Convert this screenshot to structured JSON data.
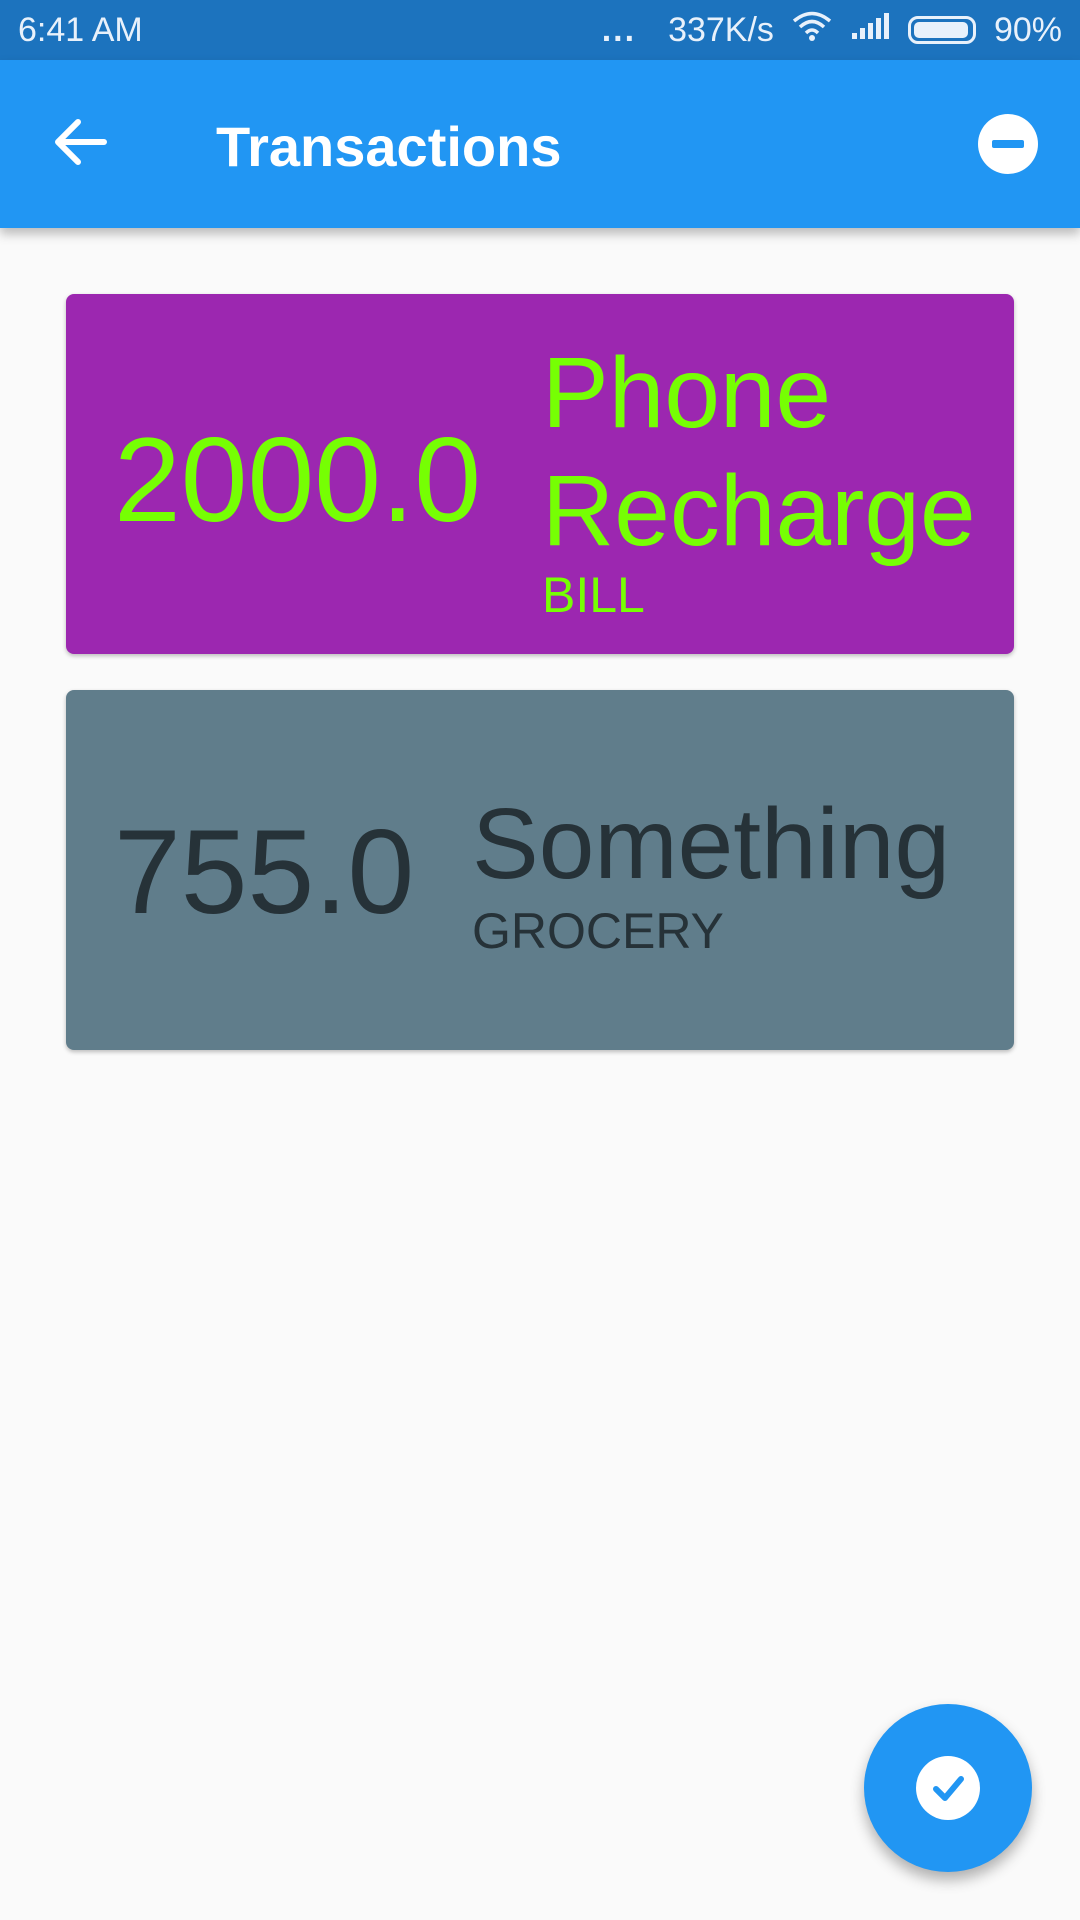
{
  "status_bar": {
    "time": "6:41 AM",
    "more": "...",
    "speed": "337K/s",
    "battery": "90%"
  },
  "app_bar": {
    "title": "Transactions",
    "back_icon": "arrow-back-icon",
    "remove_icon": "remove-circle-icon"
  },
  "transactions": [
    {
      "amount": "2000.0",
      "description": "Phone Recharge",
      "category": "BILL",
      "bg_color": "#9c27b0",
      "text_color": "#76ff03"
    },
    {
      "amount": "755.0",
      "description": "Something",
      "category": "GROCERY",
      "bg_color": "#607d8b",
      "text_color": "#263238"
    }
  ],
  "fab": {
    "icon": "check-circle-icon",
    "color": "#2196f3"
  },
  "colors": {
    "primary": "#2196f3",
    "status_bar": "#1c73be",
    "background": "#fafafa"
  }
}
